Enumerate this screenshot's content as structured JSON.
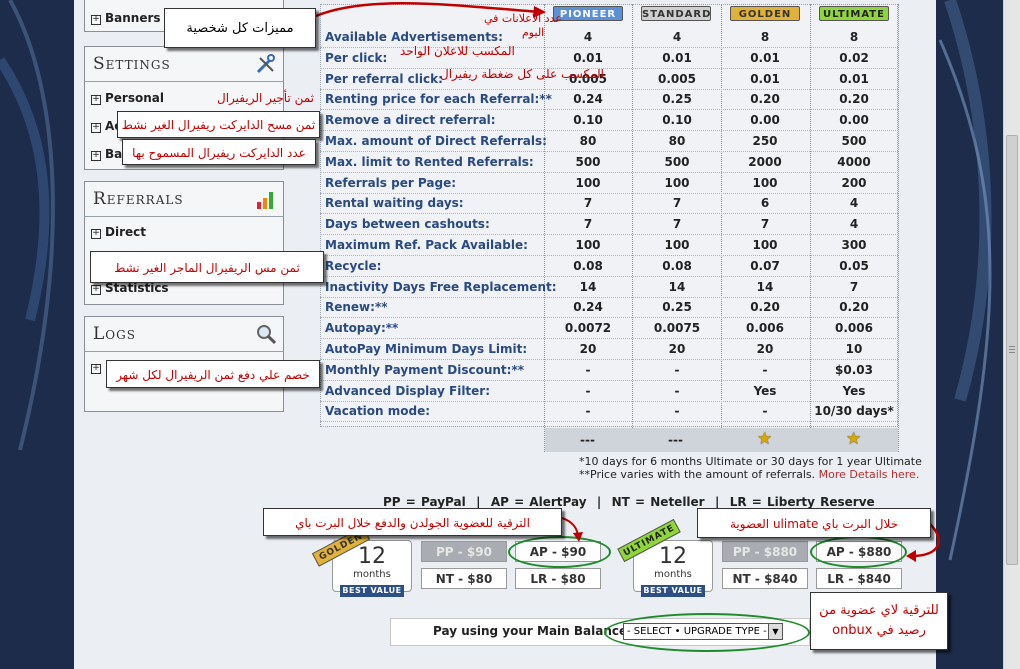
{
  "sidebar": {
    "top_item": "Banners",
    "settings": {
      "title": "Settings",
      "items": [
        "Personal",
        "Ac",
        "Ba"
      ]
    },
    "referrals": {
      "title": "Referrals",
      "items": [
        "Direct",
        "Statistics"
      ]
    },
    "logs": {
      "title": "Logs"
    }
  },
  "plans": [
    "PIONEER",
    "STANDARD",
    "GOLDEN",
    "ULTIMATE"
  ],
  "rows": [
    {
      "label": "Available Advertisements:",
      "values": [
        "4",
        "4",
        "8",
        "8"
      ]
    },
    {
      "label": "Per click:",
      "values": [
        "0.01",
        "0.01",
        "0.01",
        "0.02"
      ]
    },
    {
      "label": "Per referral click:",
      "values": [
        "0.005",
        "0.005",
        "0.01",
        "0.01"
      ]
    },
    {
      "label": "Renting price for each Referral:**",
      "values": [
        "0.24",
        "0.25",
        "0.20",
        "0.20"
      ]
    },
    {
      "label": "Remove a direct referral:",
      "values": [
        "0.10",
        "0.10",
        "0.00",
        "0.00"
      ]
    },
    {
      "label": "Max. amount of Direct Referrals:",
      "values": [
        "80",
        "80",
        "250",
        "500"
      ]
    },
    {
      "label": "Max. limit to Rented Referrals:",
      "values": [
        "500",
        "500",
        "2000",
        "4000"
      ]
    },
    {
      "label": "Referrals per Page:",
      "values": [
        "100",
        "100",
        "100",
        "200"
      ]
    },
    {
      "label": "Rental waiting days:",
      "values": [
        "7",
        "7",
        "6",
        "4"
      ]
    },
    {
      "label": "Days between cashouts:",
      "values": [
        "7",
        "7",
        "7",
        "4"
      ]
    },
    {
      "label": "Maximum Ref. Pack Available:",
      "values": [
        "100",
        "100",
        "100",
        "300"
      ]
    },
    {
      "label": "Recycle:",
      "values": [
        "0.08",
        "0.08",
        "0.07",
        "0.05"
      ]
    },
    {
      "label": "Inactivity Days Free Replacement:",
      "values": [
        "14",
        "14",
        "14",
        "7"
      ]
    },
    {
      "label": "Renew:**",
      "values": [
        "0.24",
        "0.25",
        "0.20",
        "0.20"
      ]
    },
    {
      "label": "Autopay:**",
      "values": [
        "0.0072",
        "0.0075",
        "0.006",
        "0.006"
      ]
    },
    {
      "label": "AutoPay Minimum Days Limit:",
      "values": [
        "20",
        "20",
        "20",
        "10"
      ]
    },
    {
      "label": "Monthly Payment Discount:**",
      "values": [
        "-",
        "-",
        "-",
        "$0.03"
      ]
    },
    {
      "label": "Advanced Display Filter:",
      "values": [
        "-",
        "-",
        "Yes",
        "Yes"
      ]
    },
    {
      "label": "Vacation mode:",
      "values": [
        "-",
        "-",
        "-",
        "10/30 days*"
      ]
    }
  ],
  "footer_marks": [
    "---",
    "---",
    "★",
    "★"
  ],
  "notes": {
    "n1": "*10 days for 6 months Ultimate or 30 days for 1 year Ultimate",
    "n2": "**Price varies with the amount of referrals.",
    "n2_link": "More Details here."
  },
  "legend": {
    "pp": "PP = PayPal",
    "ap": "AP = AlertPay",
    "nt": "NT = Neteller",
    "lr": "LR = Liberty Reserve"
  },
  "golden_buy": {
    "ribbon": "GOLDEN",
    "months_num": "12",
    "months_label": "months",
    "best": "BEST VALUE",
    "pp": "PP - $90",
    "ap": "AP - $90",
    "nt": "NT - $80",
    "lr": "LR - $80"
  },
  "ultimate_buy": {
    "ribbon": "ULTIMATE",
    "months_num": "12",
    "months_label": "months",
    "best": "BEST VALUE",
    "pp": "PP - $880",
    "ap": "AP - $880",
    "nt": "NT - $840",
    "lr": "LR - $840"
  },
  "pay": {
    "label": "Pay using your Main Balance:",
    "select_value": "- SELECT • UPGRADE TYPE -"
  },
  "annotations": {
    "features": "مميزات كل شخصية",
    "ads_per_day_a": "عدد الاعلانات في",
    "ads_per_day_b": "اليوم",
    "per_ad": "المكسب للاعلان الواحد",
    "per_ref_click": "المكسب على كل ضغطة ريفيرال",
    "rent_price": "ثمن تأجير الريفيرال",
    "remove_direct": "ثمن مسح الدايركت ريفيرال الغير نشط",
    "direct_allowed": "عدد الدايركت ريفيرال المسموح بها",
    "rented_cost": "ثمن مس الريفيرال الماجر الغير نشط",
    "autopay": "خصم علي دفع ثمن الريفيرال لكل شهر",
    "golden_upgrade": "الترقية للعضوية الجولدن والدفع خلال البرت باي",
    "ultimate_pay": "خلال البرت باي ulimate العضوية",
    "upgrade_balance": "للترقية لاي عضوية من رصيد في onbux"
  },
  "colors": {
    "pioneer": "#5b8fd6",
    "standard": "#c9c9c9",
    "golden": "#e0b23a",
    "ultimate": "#8fd63a",
    "annotation_red": "#c00000",
    "ellipse_green": "#1e8a2a",
    "row_label": "#2a4a80"
  }
}
